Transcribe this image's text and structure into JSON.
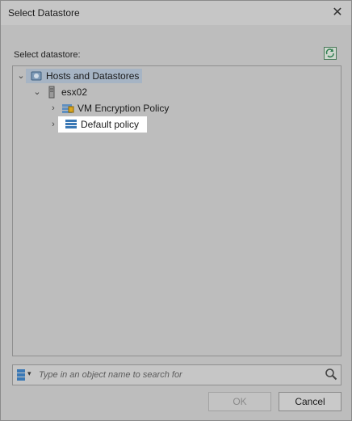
{
  "window": {
    "title": "Select Datastore"
  },
  "label": "Select datastore:",
  "tree": {
    "root": "Hosts and Datastores",
    "host": "esx02",
    "items": [
      "VM Encryption Policy",
      "Default policy"
    ]
  },
  "search": {
    "placeholder": "Type in an object name to search for"
  },
  "buttons": {
    "ok": "OK",
    "cancel": "Cancel"
  },
  "colors": {
    "selection": "#a6b4c4",
    "highlight": "#ffffff",
    "accent": "#2d6db5"
  }
}
